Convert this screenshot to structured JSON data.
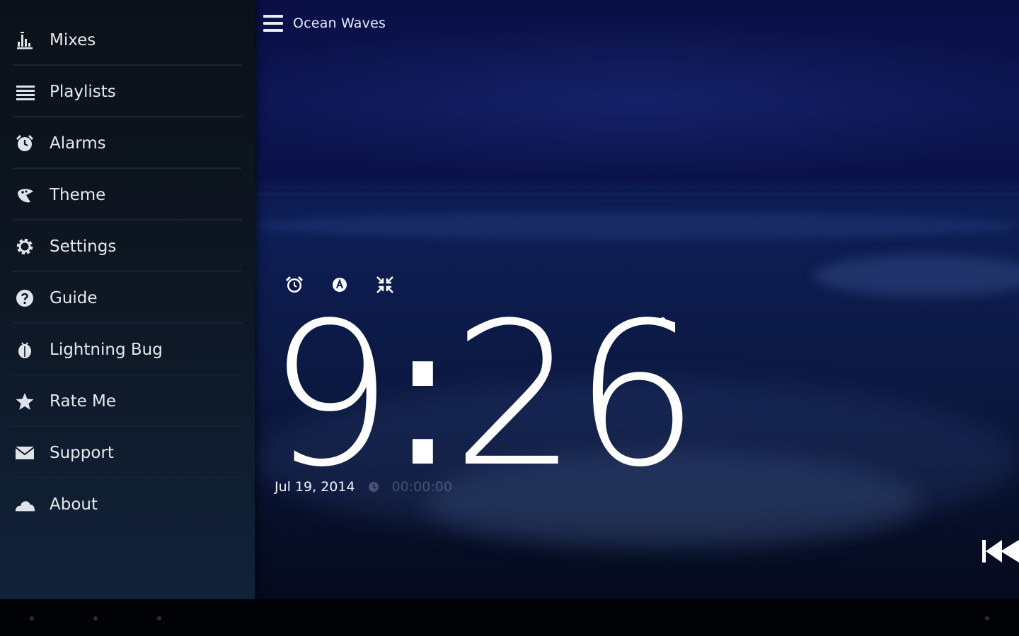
{
  "app": {
    "title": "Ocean Waves"
  },
  "drawer": {
    "items": [
      {
        "label": "Mixes",
        "icon": "equalizer-icon"
      },
      {
        "label": "Playlists",
        "icon": "list-icon"
      },
      {
        "label": "Alarms",
        "icon": "alarm-clock-icon"
      },
      {
        "label": "Theme",
        "icon": "palette-icon"
      },
      {
        "label": "Settings",
        "icon": "gear-icon"
      },
      {
        "label": "Guide",
        "icon": "help-icon"
      },
      {
        "label": "Lightning Bug",
        "icon": "lightning-bug-icon"
      },
      {
        "label": "Rate Me",
        "icon": "star-icon"
      },
      {
        "label": "Support",
        "icon": "mail-icon"
      },
      {
        "label": "About",
        "icon": "cloud-icon"
      }
    ]
  },
  "clock": {
    "hours": "9",
    "separator": ":",
    "minutes": "26",
    "date": "Jul 19, 2014",
    "timer": "00:00:00"
  },
  "colors": {
    "drawer_bg": "#0d1520",
    "text_primary": "#e6e9ee",
    "scene_bg": "#0c1450",
    "clock_text": "#ffffff"
  }
}
